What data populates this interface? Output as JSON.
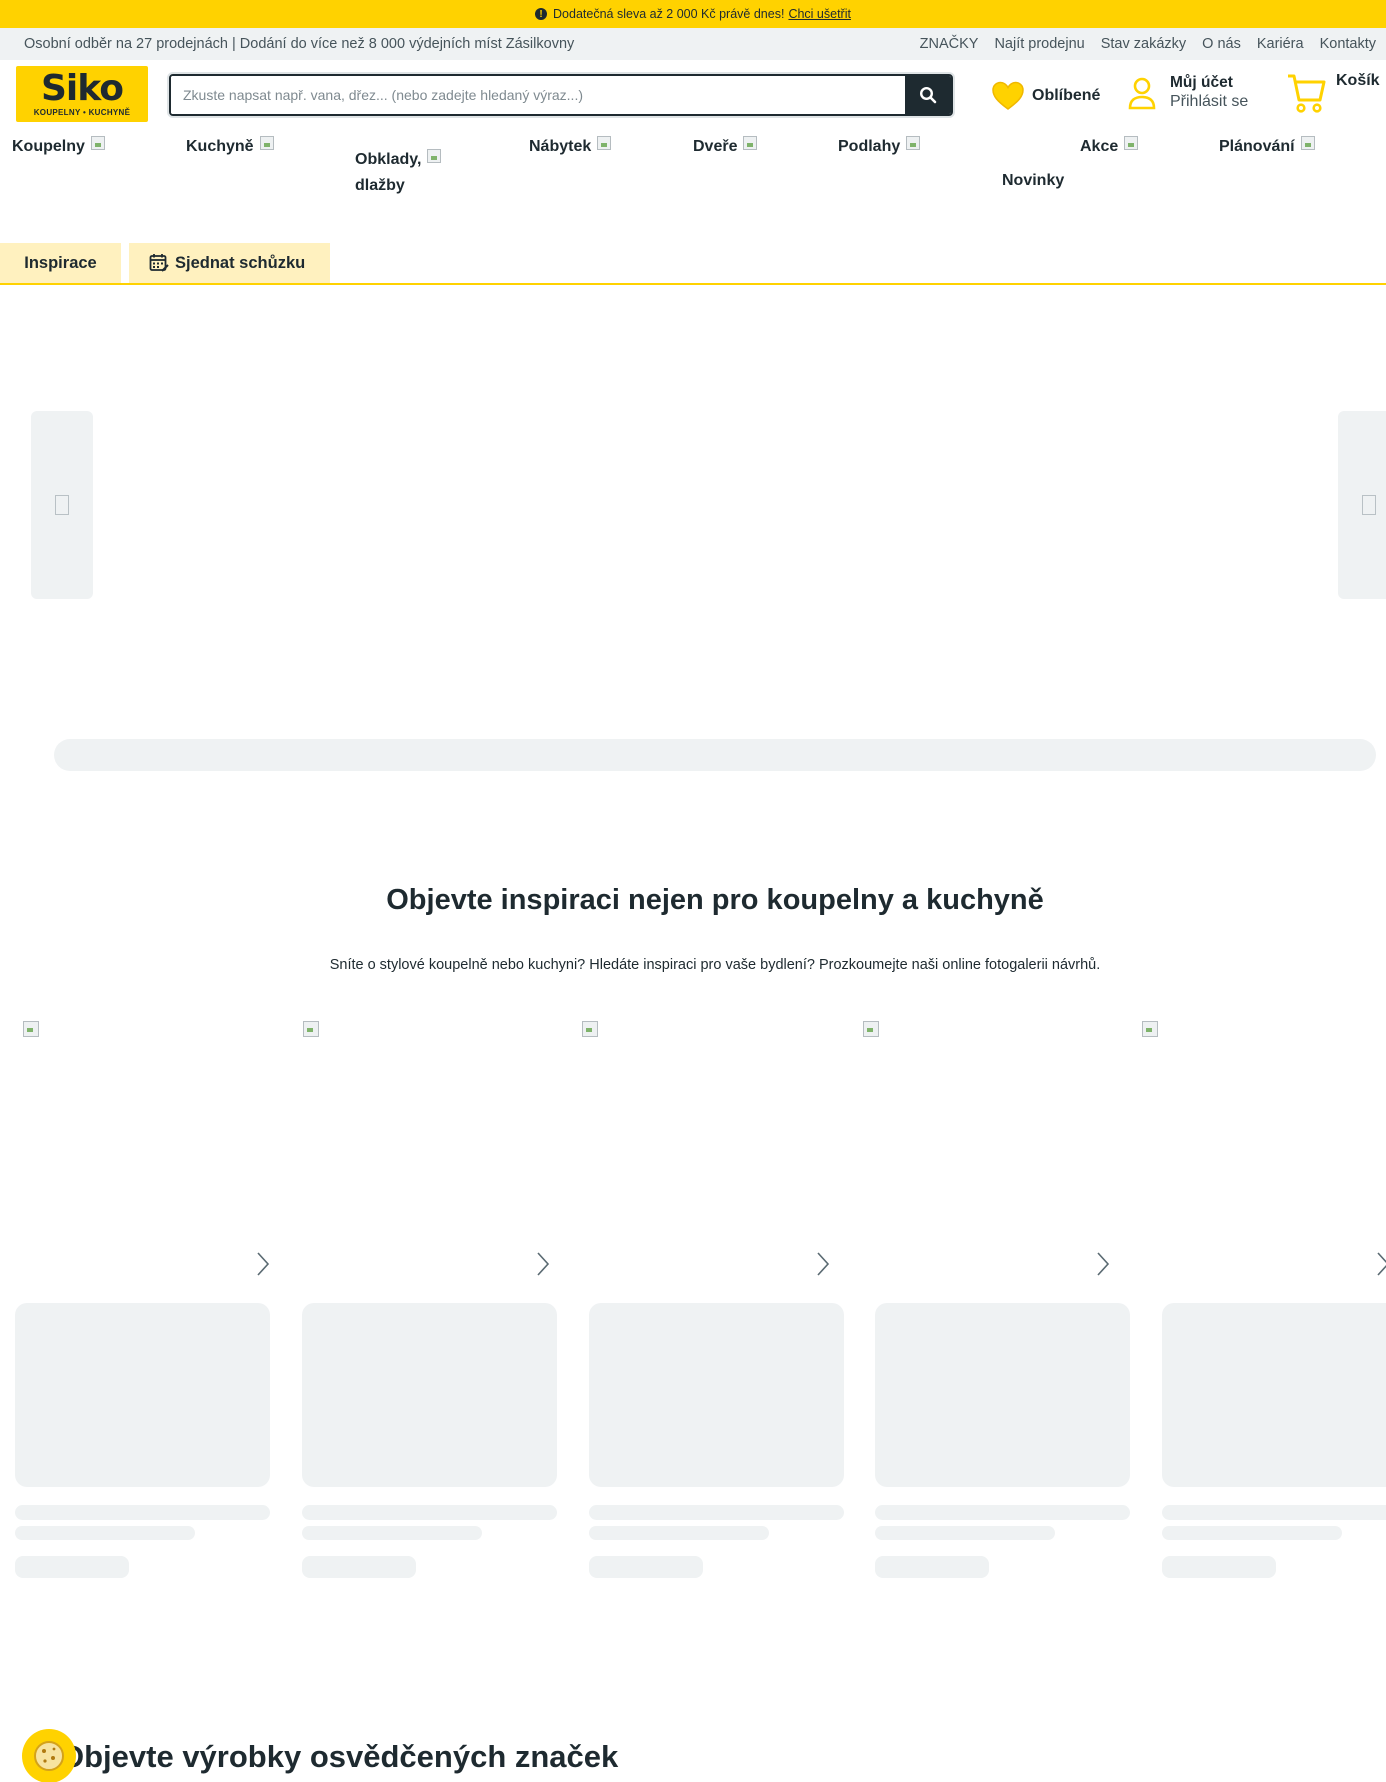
{
  "promo": {
    "text": "Dodatečná sleva až 2 000 Kč právě dnes!",
    "link": "Chci ušetřit",
    "icon": "info-icon"
  },
  "subbar": {
    "left_text": "Osobní odběr na 27 prodejnách | Dodání do více než 8 000 výdejních míst Zásilkovny",
    "links": [
      "ZNAČKY",
      "Najít prodejnu",
      "Stav zakázky",
      "O nás",
      "Kariéra",
      "Kontakty"
    ]
  },
  "header": {
    "logo_main": "Siko",
    "logo_sub": "KOUPELNY • KUCHYNĚ",
    "search_placeholder": "Zkuste napsat např. vana, dřez... (nebo zadejte hledaný výraz...)",
    "favorites_label": "Oblíbené",
    "account_title": "Můj účet",
    "account_sub": "Přihlásit se",
    "cart_label": "Košík"
  },
  "nav": {
    "items": [
      "Koupelny",
      "Kuchyně",
      "Obklady,",
      "dlažby",
      "Nábytek",
      "Dveře",
      "Podlahy",
      "Novinky",
      "Akce",
      "Plánování"
    ]
  },
  "tabs": {
    "inspirace": "Inspirace",
    "schuzka": "Sjednat schůzku"
  },
  "inspiration": {
    "title": "Objevte inspiraci nejen pro koupelny a kuchyně",
    "description": "Sníte o stylové koupelně nebo kuchyni? Hledáte inspiraci pro vaše bydlení? Prozkoumejte naši online fotogalerii návrhů."
  },
  "brands": {
    "title": "Objevte výrobky osvědčených značek"
  },
  "colors": {
    "brand_yellow": "#ffd200",
    "dark": "#1e2a30",
    "skeleton": "#eff2f3"
  }
}
